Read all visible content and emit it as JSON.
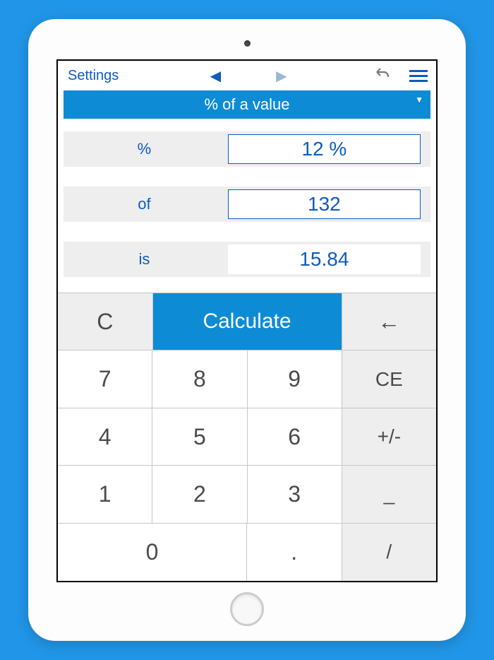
{
  "topbar": {
    "settings": "Settings"
  },
  "mode": {
    "label": "% of a value"
  },
  "rows": {
    "r1": {
      "label": "%",
      "value": "12 %"
    },
    "r2": {
      "label": "of",
      "value": "132"
    },
    "r3": {
      "label": "is",
      "value": "15.84"
    }
  },
  "actions": {
    "clear": "C",
    "calculate": "Calculate",
    "back": "←",
    "ce": "CE",
    "plusminus": "+/-",
    "dash": "_",
    "slash": "/",
    "dot": "."
  },
  "digits": {
    "d0": "0",
    "d1": "1",
    "d2": "2",
    "d3": "3",
    "d4": "4",
    "d5": "5",
    "d6": "6",
    "d7": "7",
    "d8": "8",
    "d9": "9"
  }
}
